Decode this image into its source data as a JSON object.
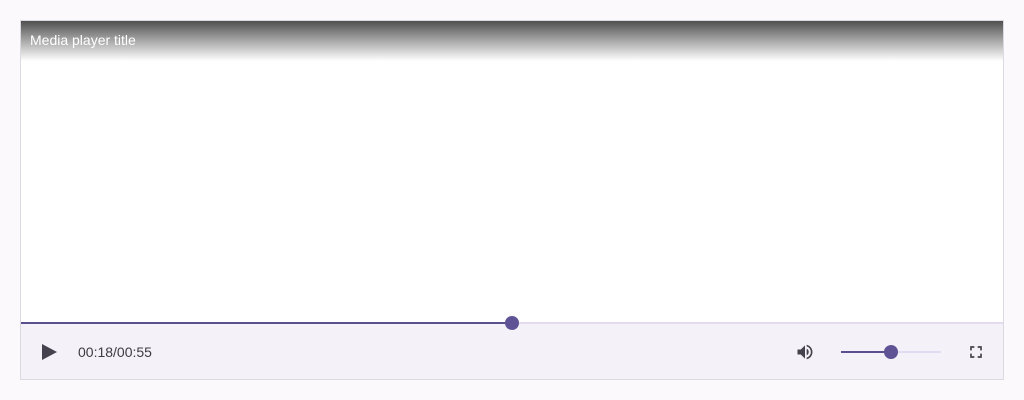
{
  "player": {
    "title": "Media player title",
    "current_time": "00:18",
    "duration": "00:55",
    "time_display": "00:18/00:55",
    "progress_fraction": 0.5,
    "volume_fraction": 0.5
  },
  "icons": {
    "play": "play-icon",
    "volume": "volume-icon",
    "fullscreen": "fullscreen-icon"
  },
  "colors": {
    "accent": "#5f5396",
    "track": "#e3dcf0",
    "controls_bg": "#f4f1f8",
    "icon": "#45424d"
  }
}
